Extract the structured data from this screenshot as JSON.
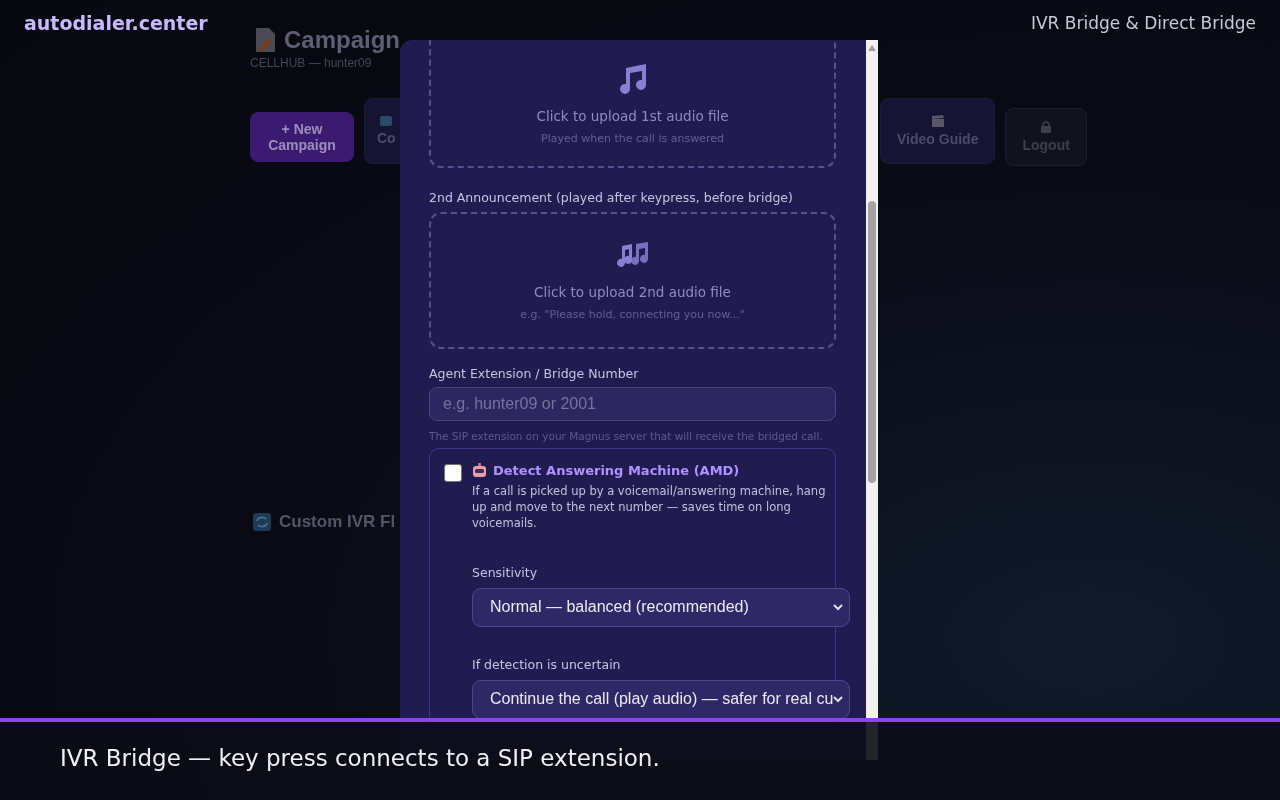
{
  "header": {
    "brand": "autodialer.center",
    "topic": "IVR Bridge & Direct Bridge"
  },
  "page": {
    "title": "Campaign",
    "subtitle": "CELLHUB — hunter09",
    "buttons": [
      {
        "label": "+ New Campaign",
        "kind": "primary"
      },
      {
        "label": "Co",
        "kind": "clipped"
      },
      {
        "label": "Video Guide",
        "kind": "video"
      },
      {
        "label": "Logout",
        "kind": "logout"
      }
    ],
    "section_title": "Custom IVR Fl"
  },
  "modal": {
    "uploads": [
      {
        "title": "Click to upload 1st audio file",
        "hint": "Played when the call is answered"
      },
      {
        "label": "2nd Announcement (played after keypress, before bridge)",
        "title": "Click to upload 2nd audio file",
        "hint": "e.g. \"Please hold, connecting you now...\""
      }
    ],
    "extension": {
      "label": "Agent Extension / Bridge Number",
      "placeholder": "e.g. hunter09 or 2001",
      "help": "The SIP extension on your Magnus server that will receive the bridged call."
    },
    "amd": {
      "checked": false,
      "title": "Detect Answering Machine (AMD)",
      "description": "If a call is picked up by a voicemail/answering machine, hang up and move to the next number — saves time on long voicemails.",
      "fields": [
        {
          "label": "Sensitivity",
          "value": "Normal — balanced (recommended)"
        },
        {
          "label": "If detection is uncertain",
          "value": "Continue the call (play audio) — safer for real cu"
        }
      ]
    }
  },
  "caption": "IVR Bridge — key press connects to a SIP extension."
}
